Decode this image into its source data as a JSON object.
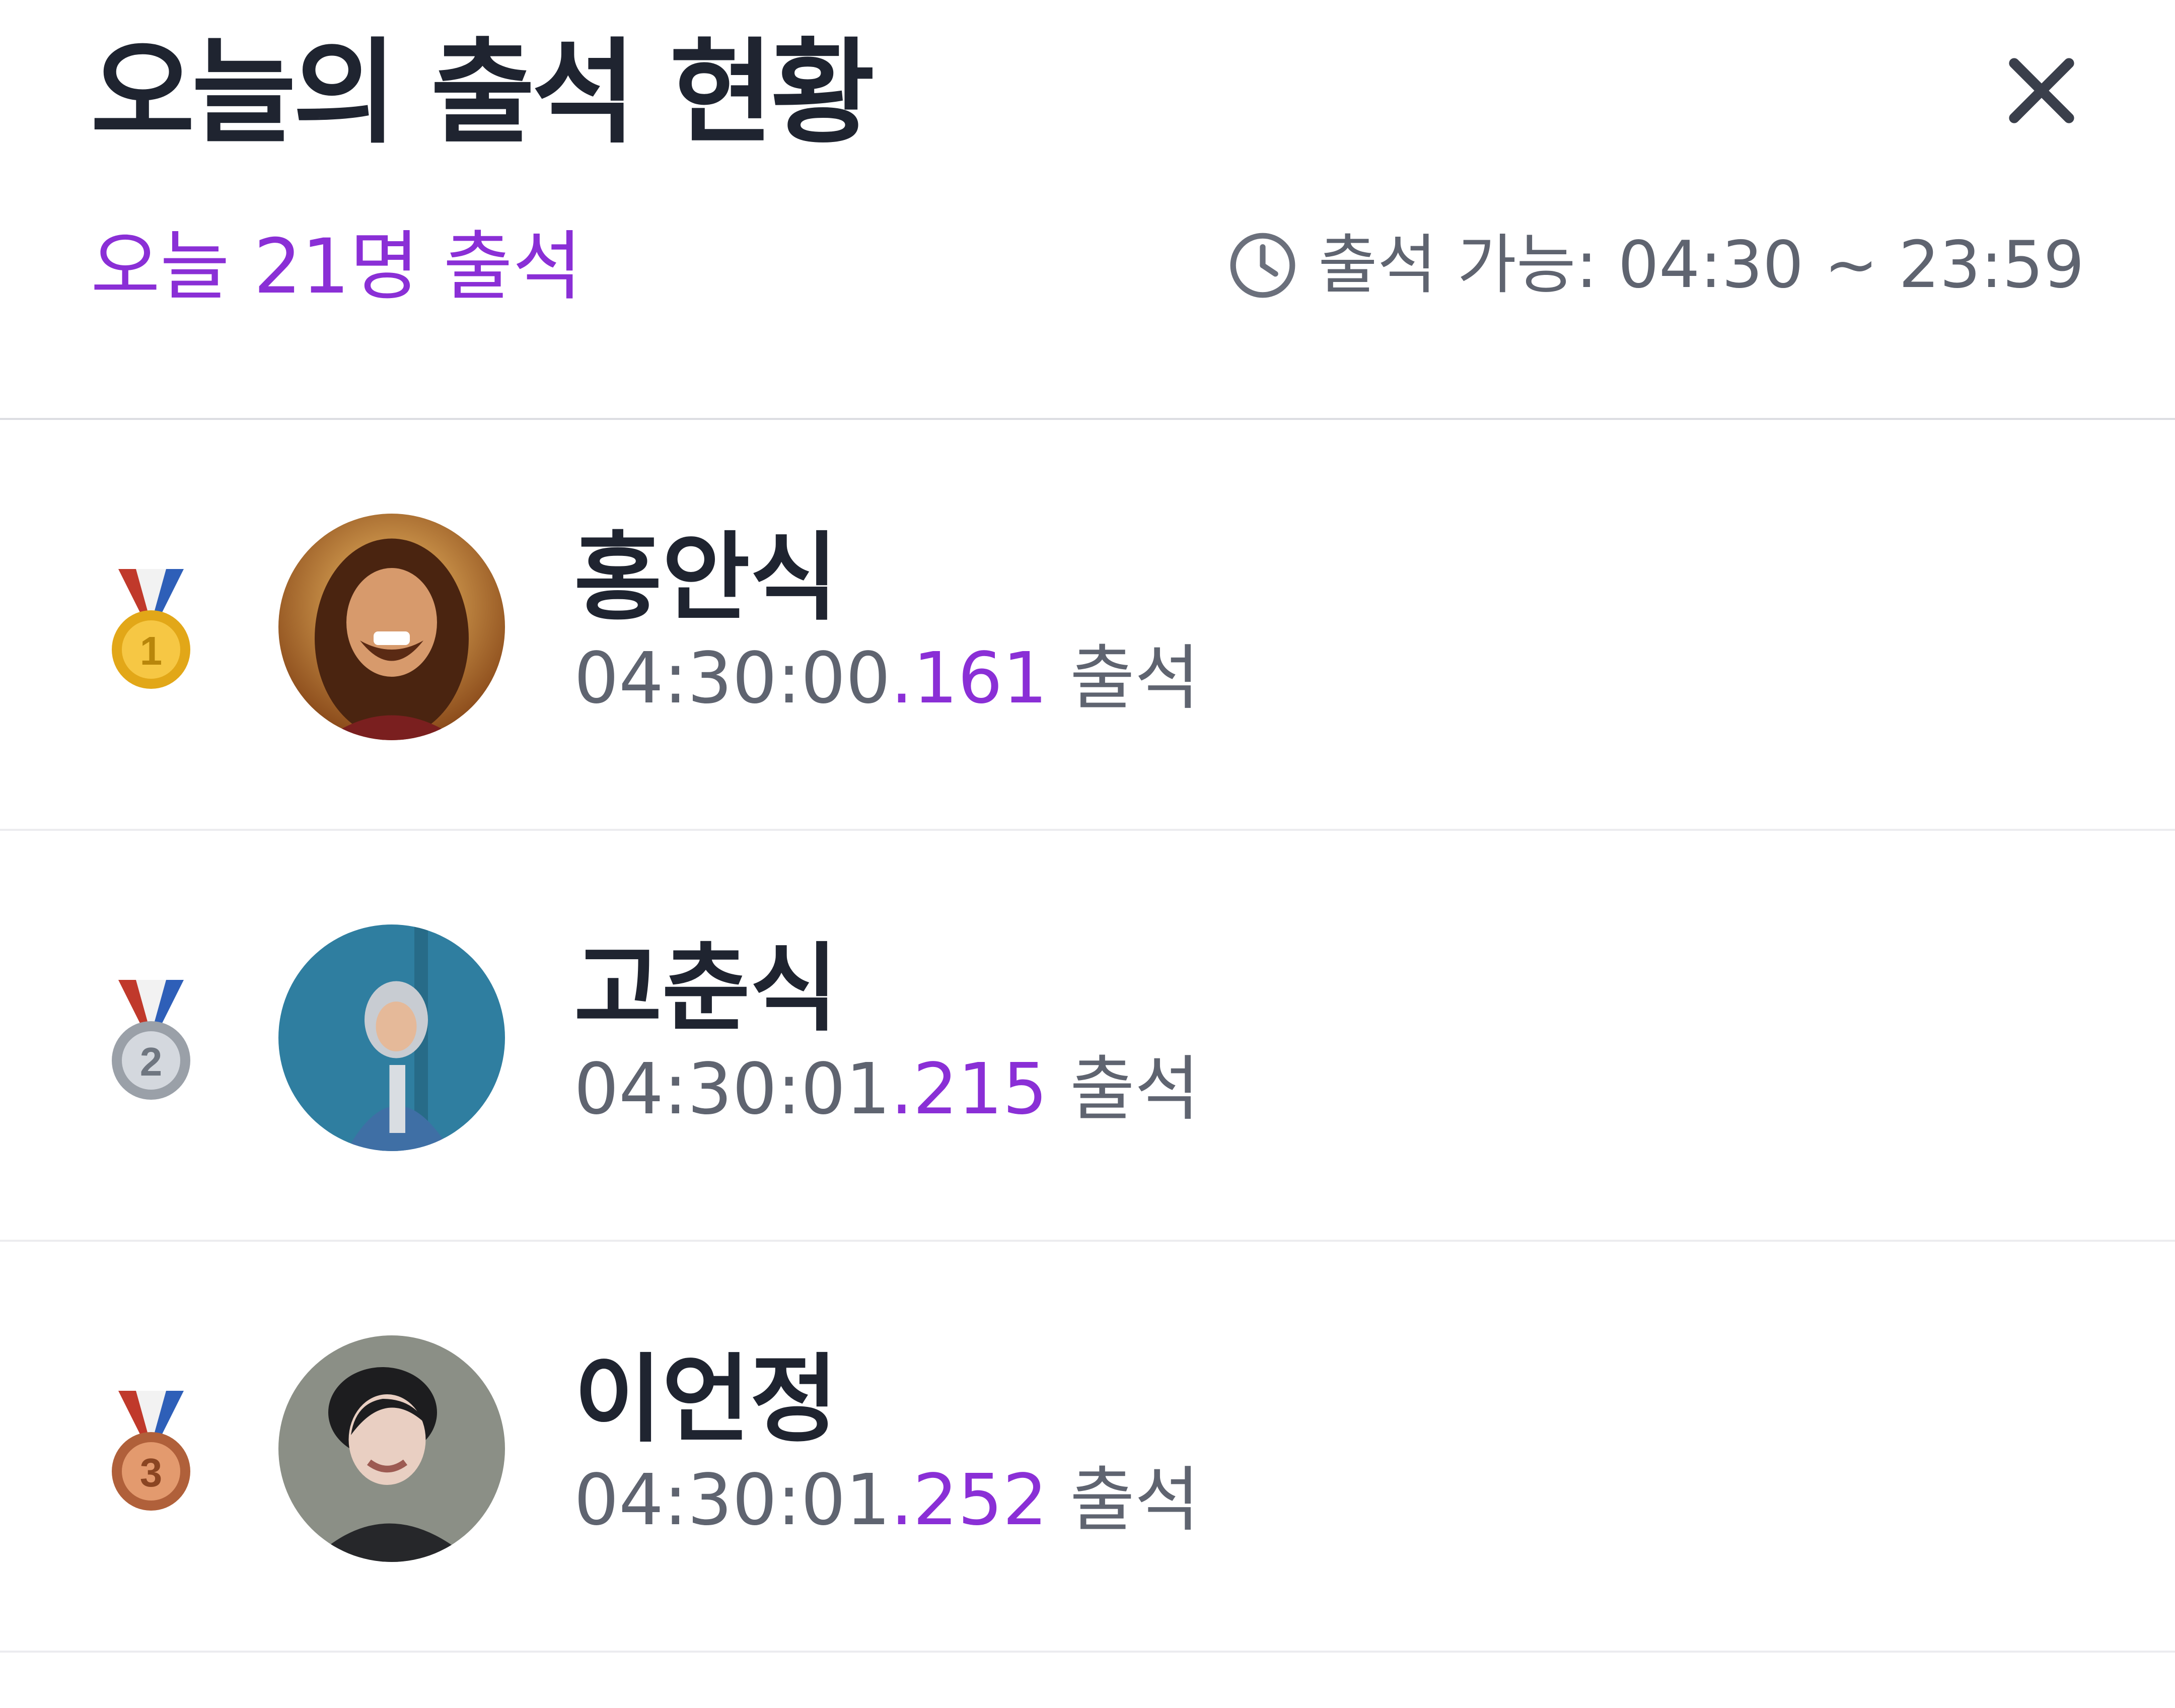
{
  "header": {
    "title": "오늘의 출석 현황",
    "attendance_count": "오늘 21명 출석",
    "window_label": "출석 가능: 04:30 ~ 23:59",
    "icons": {
      "close": "close-icon",
      "clock": "clock-icon"
    }
  },
  "colors": {
    "accent": "#8a2fd6",
    "text_primary": "#1f2430",
    "text_secondary": "#5f6470",
    "divider": "#dcdde2"
  },
  "attendees": [
    {
      "rank": "1",
      "medal": "gold-medal-icon",
      "name": "홍안식",
      "time_main": "04:30:00",
      "time_ms": ".161",
      "suffix": " 출석"
    },
    {
      "rank": "2",
      "medal": "silver-medal-icon",
      "name": "고춘식",
      "time_main": "04:30:01",
      "time_ms": ".215",
      "suffix": " 출석"
    },
    {
      "rank": "3",
      "medal": "bronze-medal-icon",
      "name": "이언정",
      "time_main": "04:30:01",
      "time_ms": ".252",
      "suffix": " 출석"
    }
  ]
}
